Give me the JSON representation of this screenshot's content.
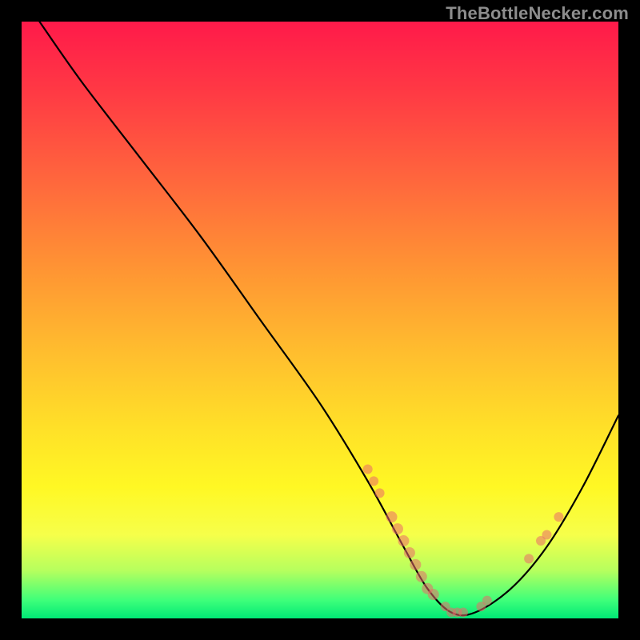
{
  "watermark": "TheBottleNecker.com",
  "chart_data": {
    "type": "line",
    "title": "",
    "xlabel": "",
    "ylabel": "",
    "xlim": [
      0,
      100
    ],
    "ylim": [
      0,
      100
    ],
    "grid": false,
    "series": [
      {
        "name": "bottleneck-curve",
        "x": [
          3,
          10,
          20,
          30,
          40,
          50,
          58,
          64,
          68,
          72,
          76,
          82,
          88,
          94,
          100
        ],
        "y": [
          100,
          90,
          77,
          64,
          50,
          36,
          23,
          12,
          5,
          1,
          1,
          5,
          12,
          22,
          34
        ]
      }
    ],
    "markers": {
      "name": "data-points",
      "points": [
        {
          "x": 58,
          "y": 25,
          "r": 6
        },
        {
          "x": 59,
          "y": 23,
          "r": 6
        },
        {
          "x": 60,
          "y": 21,
          "r": 6
        },
        {
          "x": 62,
          "y": 17,
          "r": 7
        },
        {
          "x": 63,
          "y": 15,
          "r": 7
        },
        {
          "x": 64,
          "y": 13,
          "r": 7
        },
        {
          "x": 65,
          "y": 11,
          "r": 7
        },
        {
          "x": 66,
          "y": 9,
          "r": 7
        },
        {
          "x": 67,
          "y": 7,
          "r": 7
        },
        {
          "x": 68,
          "y": 5,
          "r": 7
        },
        {
          "x": 69,
          "y": 4,
          "r": 7
        },
        {
          "x": 71,
          "y": 2,
          "r": 6
        },
        {
          "x": 72,
          "y": 1,
          "r": 6
        },
        {
          "x": 73,
          "y": 1,
          "r": 6
        },
        {
          "x": 74,
          "y": 1,
          "r": 6
        },
        {
          "x": 77,
          "y": 2,
          "r": 6
        },
        {
          "x": 78,
          "y": 3,
          "r": 6
        },
        {
          "x": 85,
          "y": 10,
          "r": 6
        },
        {
          "x": 87,
          "y": 13,
          "r": 6
        },
        {
          "x": 88,
          "y": 14,
          "r": 6
        },
        {
          "x": 90,
          "y": 17,
          "r": 6
        }
      ]
    },
    "gradient_stops": [
      {
        "pos": 0,
        "color": "#ff1a4a"
      },
      {
        "pos": 12,
        "color": "#ff3a44"
      },
      {
        "pos": 28,
        "color": "#ff6b3c"
      },
      {
        "pos": 42,
        "color": "#ff9633"
      },
      {
        "pos": 56,
        "color": "#ffbf2e"
      },
      {
        "pos": 68,
        "color": "#ffe028"
      },
      {
        "pos": 78,
        "color": "#fff824"
      },
      {
        "pos": 86,
        "color": "#f6ff4a"
      },
      {
        "pos": 92,
        "color": "#b6ff5e"
      },
      {
        "pos": 97,
        "color": "#3dff7a"
      },
      {
        "pos": 100,
        "color": "#00e876"
      }
    ]
  }
}
